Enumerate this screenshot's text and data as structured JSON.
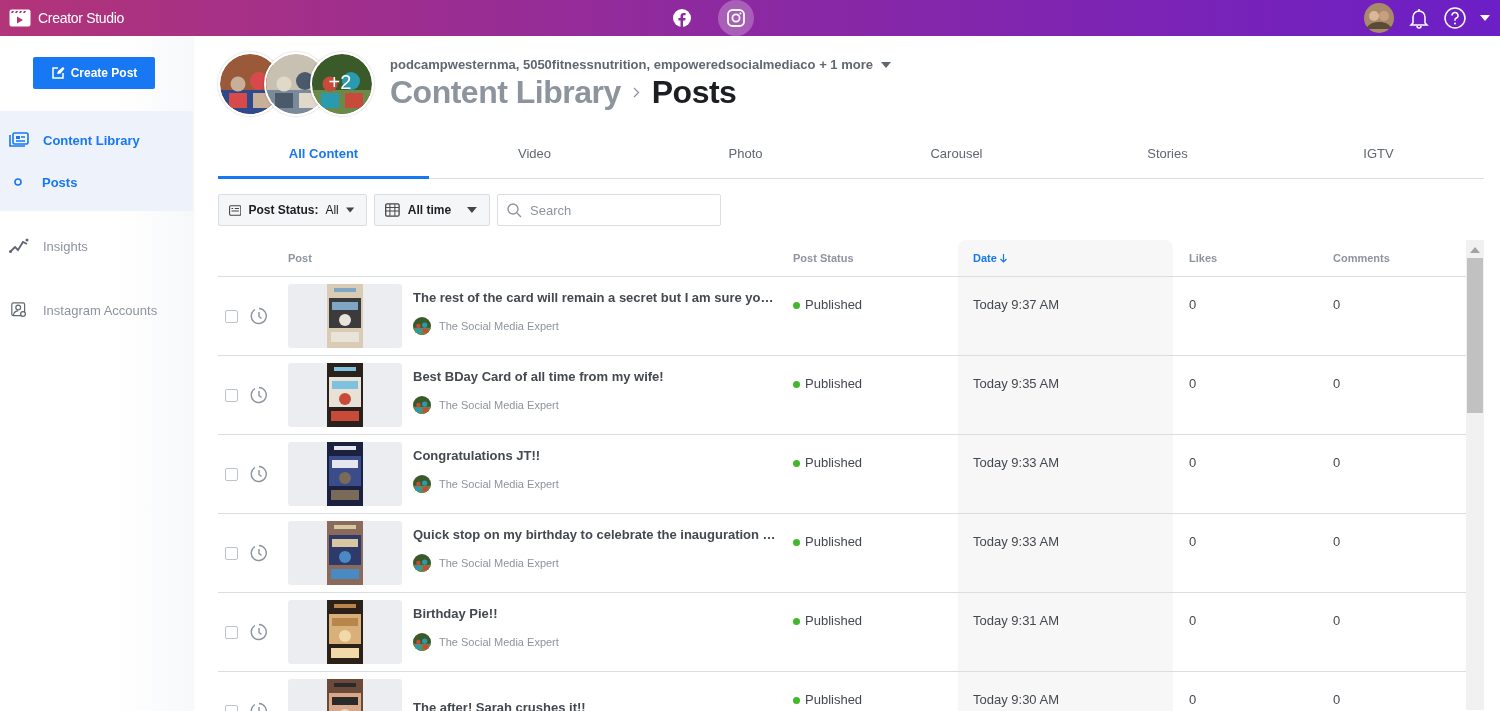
{
  "top_bar": {
    "app_title": "Creator Studio",
    "platforms": [
      {
        "kind": "facebook",
        "selected": false
      },
      {
        "kind": "instagram",
        "selected": true
      }
    ]
  },
  "sidebar": {
    "create_button": "Create Post",
    "items": [
      {
        "label": "Content Library",
        "kind": "library",
        "selected": true,
        "children": [
          {
            "label": "Posts",
            "selected": true
          }
        ]
      },
      {
        "label": "Insights",
        "kind": "insights",
        "selected": false
      },
      {
        "label": "Instagram Accounts",
        "kind": "accounts",
        "selected": false
      }
    ]
  },
  "header": {
    "accounts_extra": "+2",
    "accounts_text": "podcampwesternma, 5050fitnessnutrition, empoweredsocialmediaco + 1 more",
    "breadcrumb": [
      "Content Library",
      "Posts"
    ]
  },
  "tabs": [
    {
      "label": "All Content",
      "selected": true
    },
    {
      "label": "Video",
      "selected": false
    },
    {
      "label": "Photo",
      "selected": false
    },
    {
      "label": "Carousel",
      "selected": false
    },
    {
      "label": "Stories",
      "selected": false
    },
    {
      "label": "IGTV",
      "selected": false
    }
  ],
  "filters": {
    "status_label": "Post Status:",
    "status_value": "All",
    "time": "All time",
    "search_placeholder": "Search"
  },
  "table": {
    "columns": [
      {
        "label": "Post",
        "sorted": false
      },
      {
        "label": "Post Status",
        "sorted": false
      },
      {
        "label": "Date",
        "sorted": true
      },
      {
        "label": "Likes",
        "sorted": false
      },
      {
        "label": "Comments",
        "sorted": false
      }
    ],
    "rows": [
      {
        "checked": false,
        "title": "The rest of the card will remain a secret but I am sure yo…",
        "author": "The Social Media Expert",
        "status": "Published",
        "date": "Today 9:37 AM",
        "likes": "0",
        "comments": "0"
      },
      {
        "checked": false,
        "title": "Best BDay Card of all time from my wife!",
        "author": "The Social Media Expert",
        "status": "Published",
        "date": "Today 9:35 AM",
        "likes": "0",
        "comments": "0"
      },
      {
        "checked": false,
        "title": "Congratulations JT!!",
        "author": "The Social Media Expert",
        "status": "Published",
        "date": "Today 9:33 AM",
        "likes": "0",
        "comments": "0"
      },
      {
        "checked": false,
        "title": "Quick stop on my birthday to celebrate the inauguration …",
        "author": "The Social Media Expert",
        "status": "Published",
        "date": "Today 9:33 AM",
        "likes": "0",
        "comments": "0"
      },
      {
        "checked": false,
        "title": "Birthday Pie!!",
        "author": "The Social Media Expert",
        "status": "Published",
        "date": "Today 9:31 AM",
        "likes": "0",
        "comments": "0"
      },
      {
        "checked": false,
        "title": "The after! Sarah crushes it!!",
        "status": "Published",
        "date": "Today 9:30 AM",
        "likes": "0",
        "comments": "0"
      }
    ]
  }
}
